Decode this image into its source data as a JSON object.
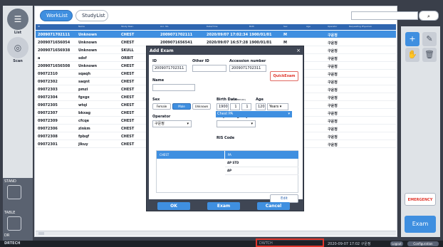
{
  "left_panel": {
    "label_list": "List",
    "label_scan": "Scan",
    "label_stand": "STAND",
    "label_table": "TABLE",
    "label_dr": "DR"
  },
  "tabs": [
    {
      "label": "WorkList"
    },
    {
      "label": "StudyList"
    }
  ],
  "search": {
    "value": ""
  },
  "table": {
    "headers": [
      "ID",
      "Name",
      "Study Desc.",
      "Acc. No.",
      "Date/Time",
      "Birth",
      "Sex",
      "Age",
      "Operator",
      "Requesting Physician"
    ],
    "rows": [
      [
        "2009071702111",
        "Unknown",
        "CHEST",
        "2009071702111",
        "2020/09/07 17:02:34",
        "1900/01/01",
        "M",
        "",
        "구운정"
      ],
      [
        "2009071656054",
        "Unknown",
        "CHEST",
        "2009071656541",
        "2020/09/07 16:57:28",
        "1900/01/01",
        "M",
        "",
        "구운정"
      ],
      [
        "2009071656938",
        "Unknown",
        "SKULL",
        "",
        "",
        "",
        "",
        "",
        "구운정"
      ],
      [
        "a",
        "sdsf",
        "ORBIT",
        "",
        "",
        "",
        "",
        "",
        "구운정"
      ],
      [
        "2009071656508",
        "Unknown",
        "CHEST",
        "",
        "",
        "",
        "",
        "",
        "구운정"
      ],
      [
        "09072310",
        "sqaqh",
        "CHEST",
        "",
        "",
        "",
        "",
        "",
        "구운정"
      ],
      [
        "09072302",
        "saqnt",
        "CHEST",
        "",
        "",
        "",
        "",
        "",
        "구운정"
      ],
      [
        "09072303",
        "pmzi",
        "CHEST",
        "",
        "",
        "",
        "",
        "",
        "구운정"
      ],
      [
        "09072304",
        "fgxgx",
        "CHEST",
        "",
        "",
        "",
        "",
        "",
        "구운정"
      ],
      [
        "09072305",
        "wtqi",
        "CHEST",
        "",
        "",
        "",
        "",
        "",
        "구운정"
      ],
      [
        "09072307",
        "bkxag",
        "CHEST",
        "",
        "",
        "",
        "",
        "",
        "구운정"
      ],
      [
        "09072309",
        "cfcqe",
        "CHEST",
        "",
        "",
        "",
        "",
        "",
        "구운정"
      ],
      [
        "09072306",
        "zlnkm",
        "CHEST",
        "",
        "",
        "",
        "",
        "",
        "구운정"
      ],
      [
        "09072308",
        "fpbqf",
        "CHEST",
        "",
        "",
        "",
        "",
        "",
        "구운정"
      ],
      [
        "09072301",
        "jlkuy",
        "CHEST",
        "",
        "",
        "",
        "",
        "",
        "구운정"
      ]
    ]
  },
  "right_panel": {
    "add_icon": "plus-icon",
    "edit_icon": "pencil-icon",
    "hand_icon": "hand-icon",
    "trash_icon": "trash-icon",
    "emergency": "EMERGENCY",
    "exam": "Exam"
  },
  "dialog": {
    "title": "Add Exam",
    "id_label": "ID",
    "id_value": "2009071702311",
    "other_id_label": "Other ID",
    "other_id_value": "",
    "acc_label": "Accession number",
    "acc_value": "2009071702311",
    "quick_exam": "QuickExam",
    "name_label": "Name",
    "name_value": "",
    "sex_label": "Sex",
    "sex_female": "Female",
    "sex_male": "Male",
    "sex_unknown": "Unknown",
    "birth_label": "Birth Date",
    "birth_hint": "(YYYY.MM.DD)",
    "birth_y": "1900",
    "birth_m": "1",
    "birth_d": "1",
    "age_label": "Age",
    "age_value": "120",
    "age_unit": "Years",
    "operator_label": "Operator",
    "operator_value": "구운정",
    "physician_label": "Requesting Physician",
    "physician_value": "",
    "ris_label": "RIS Code",
    "ris_value": "Chest PA",
    "grid_left": "CHEST",
    "grid_right": [
      "PA",
      "AP STD",
      "AP"
    ],
    "edit": "Edit",
    "ok": "OK",
    "exam": "Exam",
    "cancel": "Cancel"
  },
  "bottom": {
    "brand": "DRTECH",
    "dwitch": "DWTCH",
    "datetime": "2020-09-07 17:02 구운정",
    "logout": "Logout",
    "config": "Configuration"
  },
  "colors": {
    "accent": "#3f8fe0",
    "header": "#2f66b0",
    "emergency": "#e0352b"
  }
}
